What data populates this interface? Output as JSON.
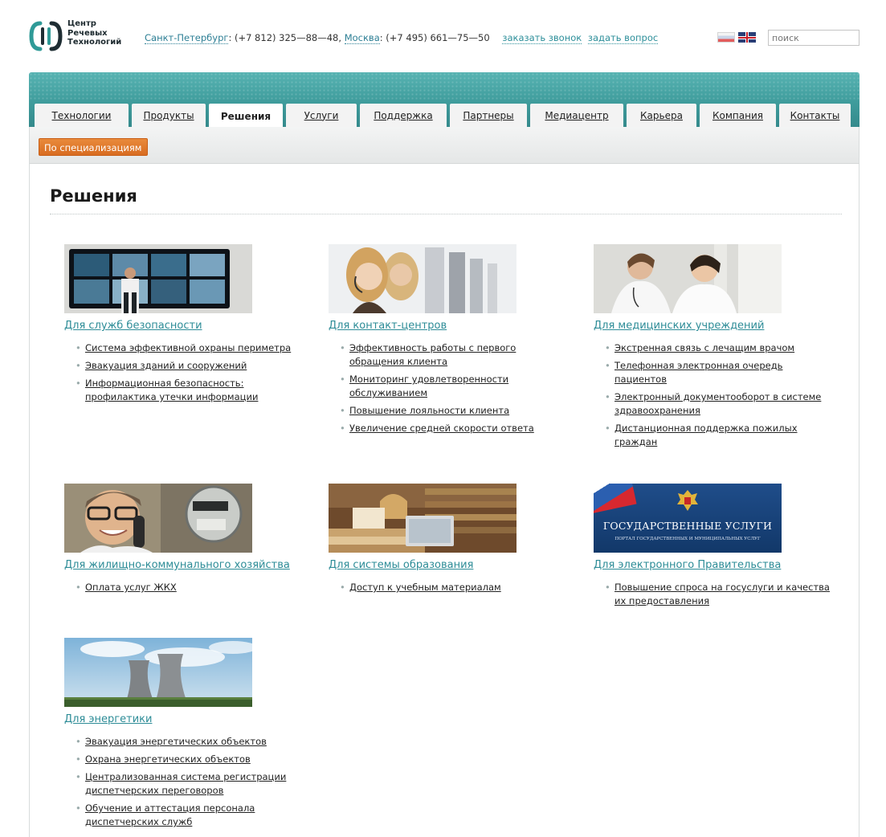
{
  "logo": {
    "lines": [
      "Центр",
      "Речевых",
      "Технологий"
    ]
  },
  "contacts": {
    "spb_city": "Санкт-Петербург",
    "spb_phone": ": (+7 812) 325—88—48, ",
    "msk_city": "Москва",
    "msk_phone": ": (+7 495) 661—75—50",
    "callback": "заказать звонок",
    "ask": "задать вопрос"
  },
  "search": {
    "placeholder": "поиск"
  },
  "nav": {
    "tabs": [
      {
        "label": "Технологии",
        "width": 117
      },
      {
        "label": "Продукты",
        "width": 92
      },
      {
        "label": "Решения",
        "width": 92
      },
      {
        "label": "Услуги",
        "width": 88
      },
      {
        "label": "Поддержка",
        "width": 108
      },
      {
        "label": "Партнеры",
        "width": 96
      },
      {
        "label": "Медиацентр",
        "width": 116
      },
      {
        "label": "Карьера",
        "width": 87
      },
      {
        "label": "Компания",
        "width": 95
      },
      {
        "label": "Контакты",
        "width": 89
      }
    ],
    "active": "Решения"
  },
  "subnav": {
    "label": "По специализациям"
  },
  "page": {
    "title": "Решения"
  },
  "blocks": [
    {
      "title": "Для служб безопасности",
      "items": [
        "Система эффективной охраны периметра",
        "Эвакуация зданий и сооружений",
        "Информационная безопасность: профилактика утечки информации"
      ]
    },
    {
      "title": "Для контакт-центров",
      "items": [
        "Эффективность работы с первого обращения клиента",
        "Мониторинг удовлетворенности обслуживанием",
        "Повышение лояльности клиента",
        "Увеличение средней скорости ответа"
      ]
    },
    {
      "title": "Для медицинских учреждений",
      "items": [
        "Экстренная связь с лечащим врачом",
        "Телефонная электронная очередь пациентов",
        "Электронный документооборот в системе здравоохранения",
        "Дистанционная поддержка пожилых граждан"
      ]
    },
    {
      "title": "Для жилищно-коммунального хозяйства",
      "items": [
        "Оплата услуг ЖКХ"
      ]
    },
    {
      "title": "Для системы образования",
      "items": [
        "Доступ к учебным материалам"
      ]
    },
    {
      "title": "Для электронного Правительства",
      "items": [
        "Повышение спроса на госуслуги и качества их предоставления"
      ],
      "banner": "ГОСУДАРСТВЕННЫЕ УСЛУГИ",
      "banner_sub": "ПОРТАЛ ГОСУДАРСТВЕННЫХ И МУНИЦИПАЛЬНЫХ УСЛУГ"
    },
    {
      "title": "Для энергетики",
      "items": [
        "Эвакуация энергетических объектов",
        "Охрана энергетических объектов",
        "Централизованная система регистрации диспетчерских переговоров",
        "Обучение и аттестация персонала диспетчерских служб"
      ]
    }
  ],
  "colors": {
    "brand_teal": "#3f9c9c",
    "link_teal": "#2d8c97",
    "accent_orange": "#e27a2e"
  }
}
